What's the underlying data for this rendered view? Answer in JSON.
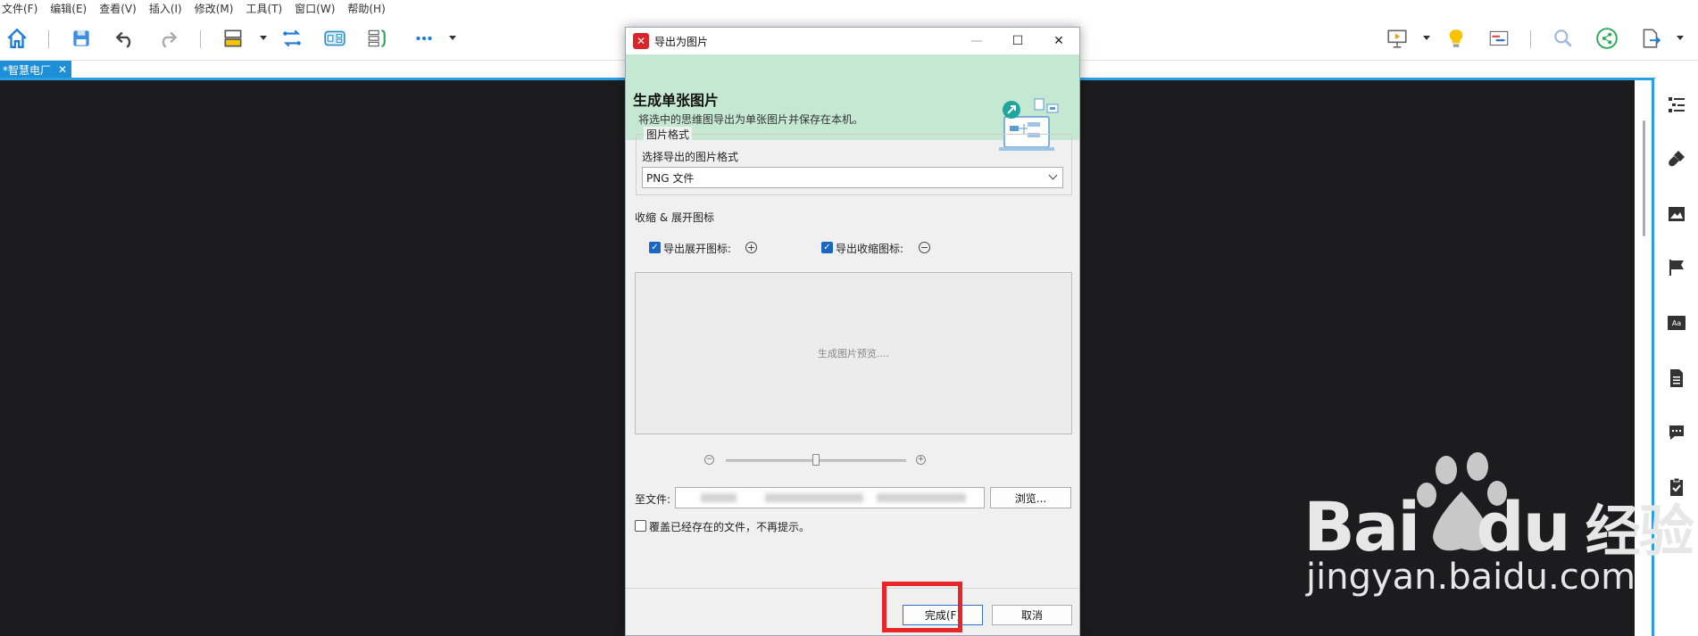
{
  "menu": [
    "文件(F)",
    "编辑(E)",
    "查看(V)",
    "插入(I)",
    "修改(M)",
    "工具(T)",
    "窗口(W)",
    "帮助(H)"
  ],
  "tab": {
    "label": "*智慧电厂",
    "close": "✕"
  },
  "dialog": {
    "title": "导出为图片",
    "minimize": "—",
    "maximize": "☐",
    "close": "✕",
    "heading": "生成单张图片",
    "subheading": "将选中的思维图导出为单张图片并保存在本机。",
    "format_group": "图片格式",
    "format_label": "选择导出的图片格式",
    "format_value": "PNG 文件",
    "collapse_section": "收缩 & 展开图标",
    "export_expand_label": "导出展开图标:",
    "export_collapse_label": "导出收缩图标:",
    "expand_checked": true,
    "collapse_checked": true,
    "preview_text": "生成图片预览....",
    "zoom_out": "−",
    "zoom_in": "+",
    "zoom_level": 0.5,
    "to_file_label": "至文件:",
    "browse_label": "浏览...",
    "overwrite_label": "覆盖已经存在的文件，不再提示。",
    "overwrite_checked": false,
    "finish_label": "完成(F)",
    "cancel_label": "取消"
  },
  "watermark": {
    "line1": "Bai",
    "line1b": "du",
    "line1c": "经验",
    "line2": "jingyan.baidu.com"
  },
  "colors": {
    "accent": "#28a0e8",
    "banner": "#c5e8d2",
    "highlight": "#e8262a",
    "canvas": "#1c1c1e"
  }
}
